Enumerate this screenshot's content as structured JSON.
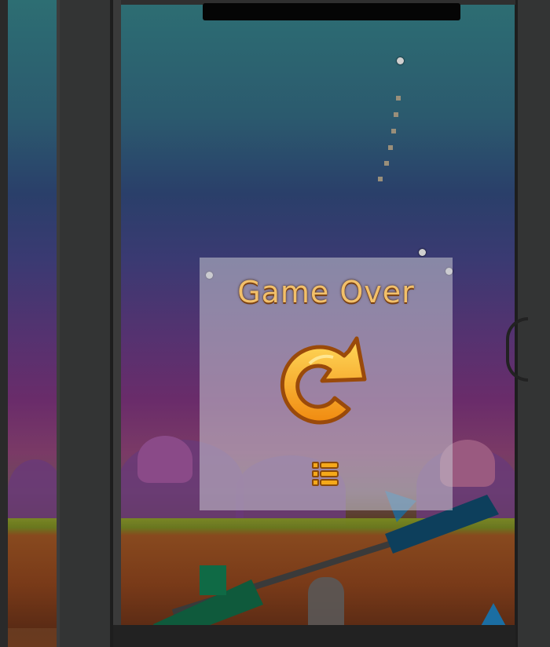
{
  "game_over": {
    "title": "Game Over",
    "retry_icon": "retry-arrow-icon",
    "menu_icon": "level-list-icon"
  },
  "colors": {
    "title_text": "#f2c06a",
    "title_outline": "#7a3f10",
    "retry_fill": "#f5a91a",
    "dialog_bg": "rgba(200,200,210,0.55)"
  }
}
